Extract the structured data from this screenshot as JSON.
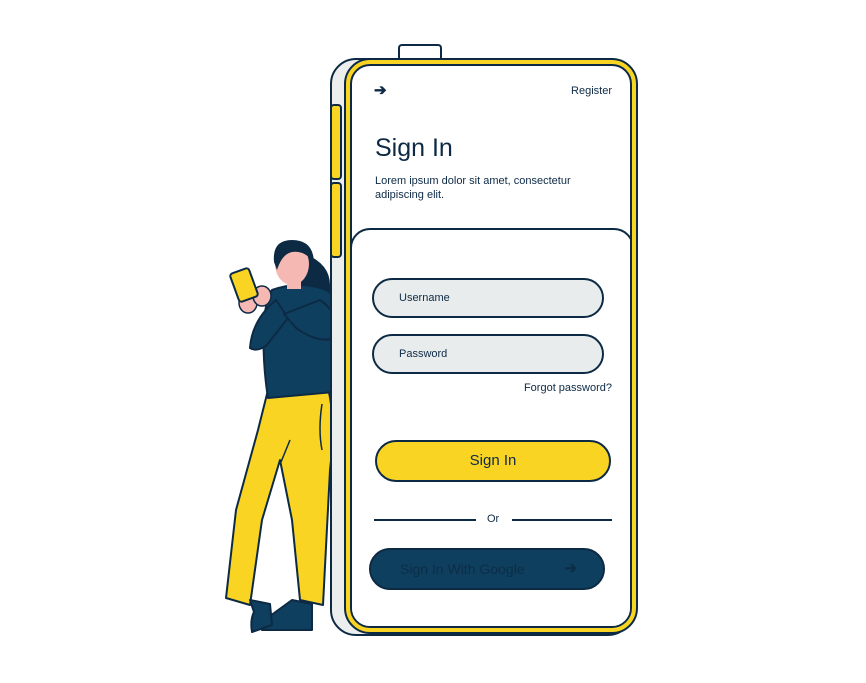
{
  "header": {
    "back_icon": "arrow-right-icon",
    "register_label": "Register"
  },
  "main": {
    "title": "Sign In",
    "subtitle": "Lorem ipsum dolor sit amet, consectetur adipiscing elit."
  },
  "form": {
    "username_placeholder": "Username",
    "password_placeholder": "Password",
    "forgot_label": "Forgot password?",
    "signin_label": "Sign In",
    "or_label": "Or",
    "google_label": "Sign In With Google",
    "google_icon": "arrow-right-icon"
  },
  "colors": {
    "accent": "#f9d423",
    "navy": "#0d2a45",
    "google_button": "#0f3f5f",
    "field_bg": "#e9ecec"
  }
}
